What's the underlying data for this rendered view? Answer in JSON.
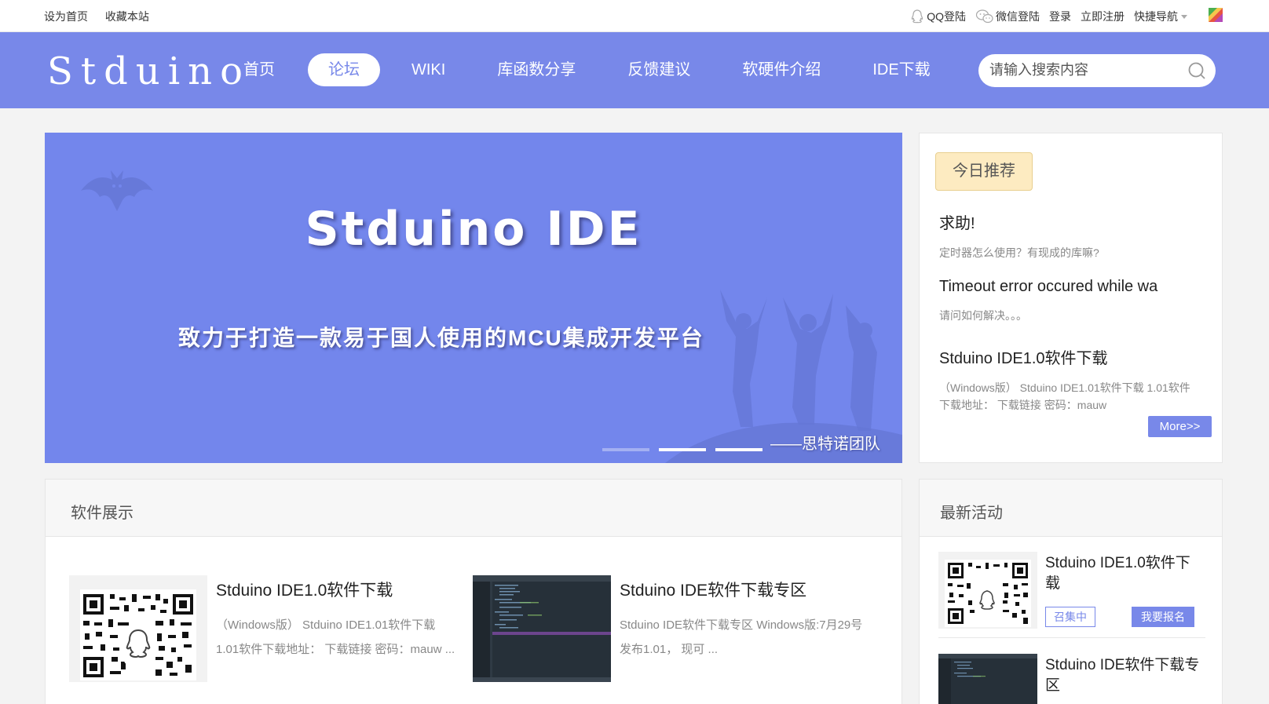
{
  "topbar": {
    "set_home": "设为首页",
    "bookmark": "收藏本站",
    "qq_login": "QQ登陆",
    "wechat_login": "微信登陆",
    "login": "登录",
    "register": "立即注册",
    "quick_nav": "快捷导航"
  },
  "header": {
    "logo": "Stduino",
    "nav": [
      "首页",
      "论坛",
      "WIKI",
      "库函数分享",
      "反馈建议",
      "软硬件介绍",
      "IDE下载"
    ],
    "active_nav": "论坛",
    "search_placeholder": "请输入搜索内容"
  },
  "banner": {
    "title": "Stduino IDE",
    "slogan": "致力于打造一款易于国人使用的MCU集成开发平台",
    "team": "——思特诺团队"
  },
  "recommend": {
    "tag": "今日推荐",
    "items": [
      {
        "title": "求助!",
        "desc": "定时器怎么使用？有现成的库嘛?"
      },
      {
        "title": "Timeout error occured while wa",
        "desc": "请问如何解决。。。"
      },
      {
        "title": "Stduino IDE1.0软件下载",
        "desc": "（Windows版） Stduino IDE1.01软件下载 1.01软件下载地址： 下载链接 密码：mauw"
      }
    ],
    "more": "More>>"
  },
  "software": {
    "heading": "软件展示",
    "cards": [
      {
        "title": "Stduino IDE1.0软件下载",
        "desc": "（Windows版） Stduino IDE1.01软件下载 1.01软件下载地址： 下载链接 密码：mauw ..."
      },
      {
        "title": "Stduino IDE软件下载专区",
        "desc": "Stduino IDE软件下载专区 Windows版:7月29号发布1.01， 现可 ..."
      }
    ]
  },
  "activities": {
    "heading": "最新活动",
    "items": [
      {
        "title": "Stduino IDE1.0软件下载",
        "badge": "召集中",
        "signup": "我要报名"
      },
      {
        "title": "Stduino IDE软件下载专区"
      }
    ]
  },
  "colors": {
    "brand": "#7888e9",
    "banner": "#7386ec",
    "tag_bg": "#fdebc1"
  }
}
